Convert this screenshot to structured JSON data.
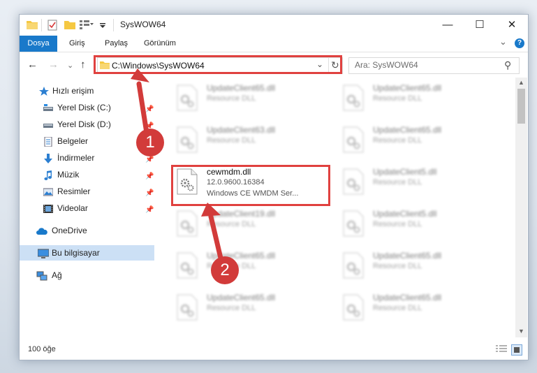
{
  "window": {
    "title": "SysWOW64",
    "minimize": "—",
    "maximize": "☐",
    "close": "✕"
  },
  "ribbon": {
    "tabs": [
      "Dosya",
      "Giriş",
      "Paylaş",
      "Görünüm"
    ],
    "collapse": "⌄",
    "help": "?"
  },
  "nav": {
    "back": "←",
    "forward": "→",
    "recent": "⌄",
    "up": "↑",
    "address": "C:\\Windows\\SysWOW64",
    "address_dropdown": "⌄",
    "refresh": "↻",
    "search_placeholder": "Ara: SysWOW64",
    "search_icon": "⚲"
  },
  "sidebar": {
    "items": [
      {
        "label": "Hızlı erişim",
        "icon": "star-icon"
      },
      {
        "label": "Yerel Disk (C:)",
        "icon": "drive-icon"
      },
      {
        "label": "Yerel Disk (D:)",
        "icon": "drive-icon"
      },
      {
        "label": "Belgeler",
        "icon": "documents-icon"
      },
      {
        "label": "İndirmeler",
        "icon": "download-icon"
      },
      {
        "label": "Müzik",
        "icon": "music-icon"
      },
      {
        "label": "Resimler",
        "icon": "pictures-icon"
      },
      {
        "label": "Videolar",
        "icon": "videos-icon"
      },
      {
        "label": "OneDrive",
        "icon": "cloud-icon"
      },
      {
        "label": "Bu bilgisayar",
        "icon": "computer-icon"
      },
      {
        "label": "Ağ",
        "icon": "network-icon"
      }
    ]
  },
  "files": {
    "left": [
      {
        "name": "UpdateClient65.dll",
        "desc": "Resource DLL"
      },
      {
        "name": "UpdateClient63.dll",
        "desc": "Resource DLL"
      },
      {
        "name": "cewmdm.dll",
        "version": "12.0.9600.16384",
        "desc": "Windows CE WMDM Ser..."
      },
      {
        "name": "UpdateClient19.dll",
        "desc": "Resource DLL"
      },
      {
        "name": "UpdateClient65.dll",
        "desc": "Resource DLL"
      },
      {
        "name": "UpdateClient65.dll",
        "desc": "Resource DLL"
      }
    ],
    "right": [
      {
        "name": "UpdateClient65.dll",
        "desc": "Resource DLL"
      },
      {
        "name": "UpdateClient65.dll",
        "desc": "Resource DLL"
      },
      {
        "name": "UpdateClient5.dll",
        "desc": "Resource DLL"
      },
      {
        "name": "UpdateClient5.dll",
        "desc": "Resource DLL"
      },
      {
        "name": "UpdateClient65.dll",
        "desc": "Resource DLL"
      },
      {
        "name": "UpdateClient65.dll",
        "desc": "Resource DLL"
      }
    ]
  },
  "status": {
    "count": "100 öğe"
  },
  "annotations": {
    "badge1": "1",
    "badge2": "2"
  },
  "colors": {
    "accent": "#1979ca",
    "highlight": "#e0413f",
    "selection": "#cce0f5",
    "folder": "#f5c842"
  }
}
